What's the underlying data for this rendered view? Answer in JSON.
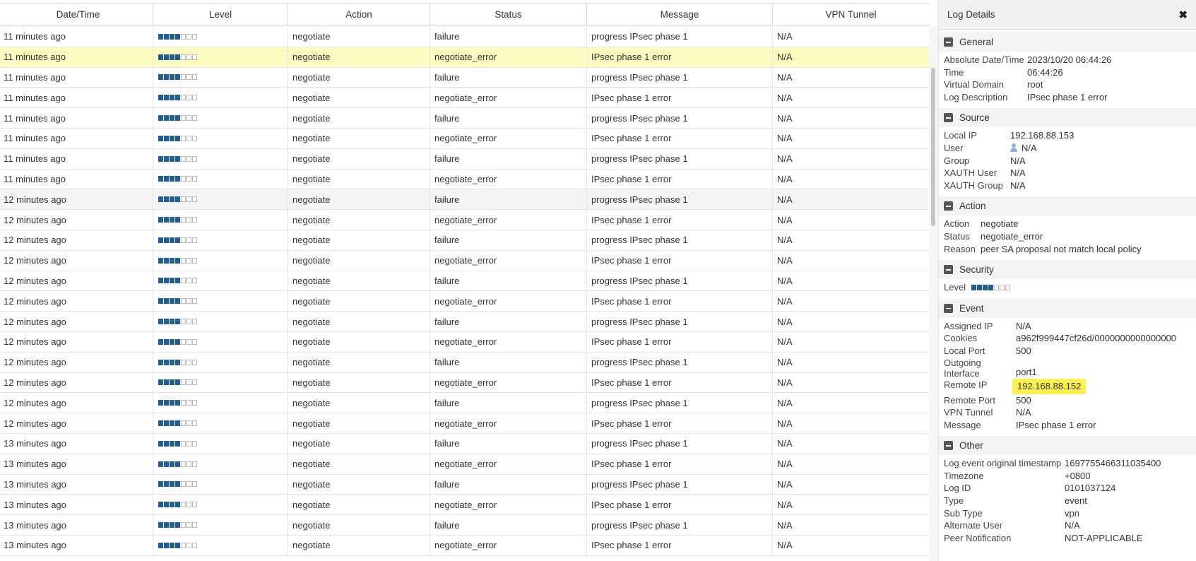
{
  "table": {
    "columns": [
      "Date/Time",
      "Level",
      "Action",
      "Status",
      "Message",
      "VPN Tunnel"
    ],
    "rows": [
      [
        "11 minutes ago",
        "negotiate",
        "failure",
        "progress IPsec phase 1",
        "N/A"
      ],
      [
        "11 minutes ago",
        "negotiate",
        "negotiate_error",
        "IPsec phase 1 error",
        "N/A"
      ],
      [
        "11 minutes ago",
        "negotiate",
        "failure",
        "progress IPsec phase 1",
        "N/A"
      ],
      [
        "11 minutes ago",
        "negotiate",
        "negotiate_error",
        "IPsec phase 1 error",
        "N/A"
      ],
      [
        "11 minutes ago",
        "negotiate",
        "failure",
        "progress IPsec phase 1",
        "N/A"
      ],
      [
        "11 minutes ago",
        "negotiate",
        "negotiate_error",
        "IPsec phase 1 error",
        "N/A"
      ],
      [
        "11 minutes ago",
        "negotiate",
        "failure",
        "progress IPsec phase 1",
        "N/A"
      ],
      [
        "11 minutes ago",
        "negotiate",
        "negotiate_error",
        "IPsec phase 1 error",
        "N/A"
      ],
      [
        "12 minutes ago",
        "negotiate",
        "failure",
        "progress IPsec phase 1",
        "N/A"
      ],
      [
        "12 minutes ago",
        "negotiate",
        "negotiate_error",
        "IPsec phase 1 error",
        "N/A"
      ],
      [
        "12 minutes ago",
        "negotiate",
        "failure",
        "progress IPsec phase 1",
        "N/A"
      ],
      [
        "12 minutes ago",
        "negotiate",
        "negotiate_error",
        "IPsec phase 1 error",
        "N/A"
      ],
      [
        "12 minutes ago",
        "negotiate",
        "failure",
        "progress IPsec phase 1",
        "N/A"
      ],
      [
        "12 minutes ago",
        "negotiate",
        "negotiate_error",
        "IPsec phase 1 error",
        "N/A"
      ],
      [
        "12 minutes ago",
        "negotiate",
        "failure",
        "progress IPsec phase 1",
        "N/A"
      ],
      [
        "12 minutes ago",
        "negotiate",
        "negotiate_error",
        "IPsec phase 1 error",
        "N/A"
      ],
      [
        "12 minutes ago",
        "negotiate",
        "failure",
        "progress IPsec phase 1",
        "N/A"
      ],
      [
        "12 minutes ago",
        "negotiate",
        "negotiate_error",
        "IPsec phase 1 error",
        "N/A"
      ],
      [
        "12 minutes ago",
        "negotiate",
        "failure",
        "progress IPsec phase 1",
        "N/A"
      ],
      [
        "12 minutes ago",
        "negotiate",
        "negotiate_error",
        "IPsec phase 1 error",
        "N/A"
      ],
      [
        "13 minutes ago",
        "negotiate",
        "failure",
        "progress IPsec phase 1",
        "N/A"
      ],
      [
        "13 minutes ago",
        "negotiate",
        "negotiate_error",
        "IPsec phase 1 error",
        "N/A"
      ],
      [
        "13 minutes ago",
        "negotiate",
        "failure",
        "progress IPsec phase 1",
        "N/A"
      ],
      [
        "13 minutes ago",
        "negotiate",
        "negotiate_error",
        "IPsec phase 1 error",
        "N/A"
      ],
      [
        "13 minutes ago",
        "negotiate",
        "failure",
        "progress IPsec phase 1",
        "N/A"
      ],
      [
        "13 minutes ago",
        "negotiate",
        "negotiate_error",
        "IPsec phase 1 error",
        "N/A"
      ]
    ],
    "level_filled": 4,
    "level_total": 7,
    "selected_row": 1,
    "hover_row": 8
  },
  "colors": {
    "level_fill": "#1f5e8e",
    "selected_row": "#fcfcc0",
    "highlight_marker": "#fcf14e"
  },
  "details": {
    "title": "Log Details",
    "close_glyph": "✖",
    "sections": [
      {
        "title": "General",
        "key_width": 118,
        "items": [
          {
            "k": "Absolute Date/Time",
            "v": "2023/10/20 06:44:26"
          },
          {
            "k": "Time",
            "v": "06:44:26"
          },
          {
            "k": "Virtual Domain",
            "v": "root"
          },
          {
            "k": "Log Description",
            "v": "IPsec phase 1 error"
          }
        ]
      },
      {
        "title": "Source",
        "key_width": 94,
        "items": [
          {
            "k": "Local IP",
            "v": "192.168.88.153"
          },
          {
            "k": "User",
            "v": "N/A",
            "icon": "user-icon"
          },
          {
            "k": "Group",
            "v": "N/A"
          },
          {
            "k": "XAUTH User",
            "v": "N/A"
          },
          {
            "k": "XAUTH Group",
            "v": "N/A"
          }
        ]
      },
      {
        "title": "Action",
        "key_width": 52,
        "items": [
          {
            "k": "Action",
            "v": "negotiate"
          },
          {
            "k": "Status",
            "v": "negotiate_error"
          },
          {
            "k": "Reason",
            "v": "peer SA proposal not match local policy"
          }
        ]
      },
      {
        "title": "Security",
        "key_width": 38,
        "items": [
          {
            "k": "Level",
            "v": "",
            "level": true
          }
        ]
      },
      {
        "title": "Event",
        "key_width": 102,
        "items": [
          {
            "k": "Assigned IP",
            "v": "N/A"
          },
          {
            "k": "Cookies",
            "v": "a962f999447cf26d/0000000000000000"
          },
          {
            "k": "Local Port",
            "v": "500"
          },
          {
            "k": "Outgoing Interface",
            "v": "port1",
            "tall": true
          },
          {
            "k": "Remote IP",
            "v": "192.168.88.152",
            "highlight": true
          },
          {
            "k": "Remote Port",
            "v": "500"
          },
          {
            "k": "VPN Tunnel",
            "v": "N/A"
          },
          {
            "k": "Message",
            "v": "IPsec phase 1 error"
          }
        ]
      },
      {
        "title": "Other",
        "key_width": 171,
        "items": [
          {
            "k": "Log event original timestamp",
            "v": "1697755466311035400"
          },
          {
            "k": "Timezone",
            "v": "+0800"
          },
          {
            "k": "Log ID",
            "v": "0101037124"
          },
          {
            "k": "Type",
            "v": "event"
          },
          {
            "k": "Sub Type",
            "v": "vpn"
          },
          {
            "k": "Alternate User",
            "v": "N/A"
          },
          {
            "k": "Peer Notification",
            "v": "NOT-APPLICABLE"
          }
        ]
      }
    ]
  }
}
